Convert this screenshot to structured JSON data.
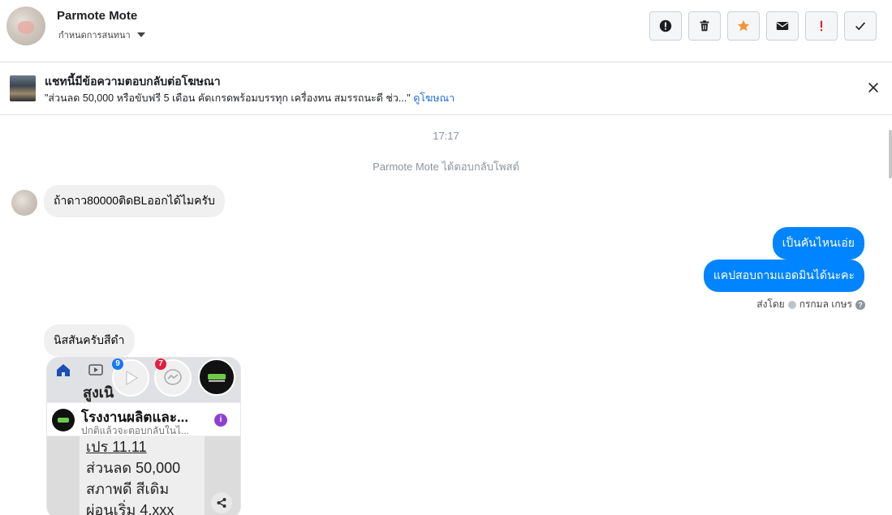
{
  "header": {
    "contact_name": "Parmote Mote",
    "assign_label": "กำหนดการสนทนา"
  },
  "actions": [
    {
      "name": "mark-spam",
      "icon": "exclamation-circle-icon"
    },
    {
      "name": "delete",
      "icon": "trash-icon"
    },
    {
      "name": "star",
      "icon": "star-icon",
      "color": "#f7923a"
    },
    {
      "name": "mark-unread",
      "icon": "envelope-icon"
    },
    {
      "name": "follow-up",
      "icon": "exclamation-icon",
      "color": "#e41e3f"
    },
    {
      "name": "mark-done",
      "icon": "check-icon"
    }
  ],
  "ad_banner": {
    "title": "แชทนี้มีข้อความตอบกลับต่อโฆษณา",
    "text": "\"ส่วนลด 50,000 หรือขับฟรี 5 เดือน คัดเกรดพร้อมบรรทุก เครื่องทน สมรรถนะดี ช่ว...\"",
    "link": "ดูโฆษณา"
  },
  "thread": {
    "timestamp": "17:17",
    "system_message": "Parmote Mote ได้ตอบกลับโพสต์",
    "messages": [
      {
        "direction": "in",
        "text": "ถ้าดาว80000ติดBLออกได้ไมครับ"
      },
      {
        "direction": "out",
        "text": "เป็นคันไหนเอ่ย"
      },
      {
        "direction": "out",
        "text": "แคปสอบถามแอดมินได้นะคะ"
      },
      {
        "direction": "in",
        "text": "นิสสันครับสีดำ"
      }
    ],
    "sent_by_label": "ส่งโดย",
    "sent_by_name": "กรกมล เกษร"
  },
  "shared_card": {
    "headline": "สูงเนิ",
    "badge_play": "9",
    "badge_messenger": "7",
    "page_name": "โรงงานผลิตและ...",
    "page_sub": "ปกติแล้วจะตอบกลับในไ...",
    "post_lines": [
      "เปร 11.11",
      "ส่วนลด 50,000",
      "สภาพดี สีเดิม",
      "ผ่อนเริ่ม 4,xxx"
    ]
  }
}
